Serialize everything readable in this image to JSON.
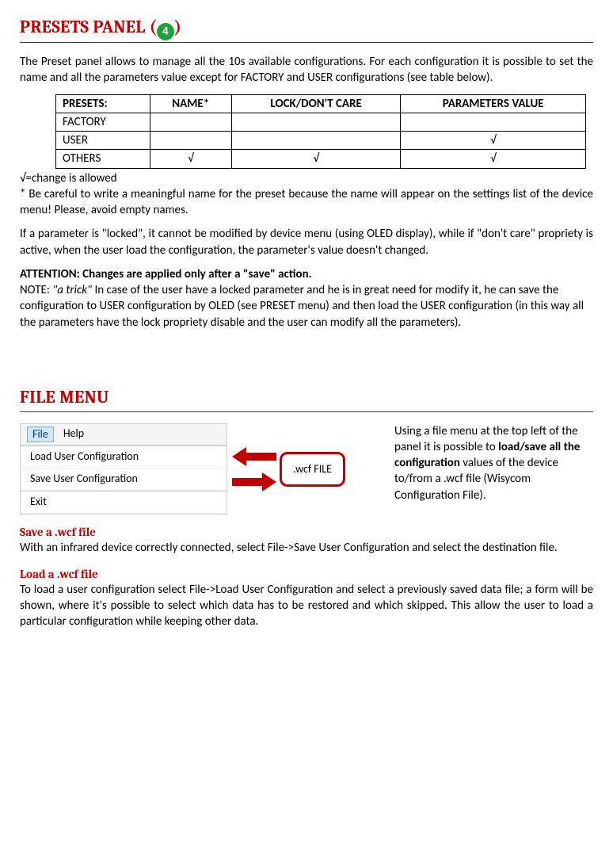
{
  "sections": {
    "presets": {
      "title_pre": "PRESETS PANEL (",
      "title_post": ")",
      "badge": "4",
      "intro": "The Preset panel allows to manage all the 10s available configurations. For each configuration it is possible to set the name and all the parameters value except for FACTORY and USER configurations (see table below).",
      "table": {
        "headers": [
          "PRESETS:",
          "NAME*",
          "LOCK/DON'T CARE",
          "PARAMETERS VALUE"
        ],
        "rows": [
          [
            "FACTORY",
            "",
            "",
            ""
          ],
          [
            "USER",
            "",
            "",
            "√"
          ],
          [
            "OTHERS",
            "√",
            "√",
            "√"
          ]
        ]
      },
      "legend1": "√=change is allowed",
      "legend2": "* Be careful to write a meaningful name for the preset because the name will appear on the settings list of the device menu! Please, avoid empty names.",
      "locked_para": "If a parameter is \"locked\", it cannot be modified by device menu (using OLED display), while if \"don't care\" propriety is active, when the user load the configuration, the parameter's value doesn't changed.",
      "attention": "ATTENTION: Changes are applied only after a \"save\" action.",
      "note_label": "NOTE: ",
      "note_trick": "\"a trick\"",
      "note_body": " In case of the user have a locked parameter and he is in great need for modify it, he can save the configuration to USER configuration by OLED (see PRESET menu) and then load the USER configuration (in this way all the parameters have the lock propriety disable and the user can modify all the parameters)."
    },
    "file_menu": {
      "title": "FILE MENU",
      "menu": {
        "file": "File",
        "help": "Help",
        "items": [
          "Load User Configuration",
          "Save User Configuration",
          "Exit"
        ]
      },
      "wcf_label": ".wcf FILE",
      "desc_pre": "Using a file menu at the top left of the panel it is possible to ",
      "desc_bold": "load/save all the configuration",
      "desc_post": " values of the device to/from a .wcf file (Wisycom Configuration File).",
      "save_h": "Save a .wcf file",
      "save_p": "With an infrared device correctly connected, select File->Save User Configuration and select the destination file.",
      "load_h": "Load a .wcf file",
      "load_p": " To load a user configuration select File->Load User Configuration and select a previously saved data file; a form will be shown, where it's possible to select which data has to be restored and which skipped. This allow the user to load a particular configuration while keeping other data."
    }
  }
}
